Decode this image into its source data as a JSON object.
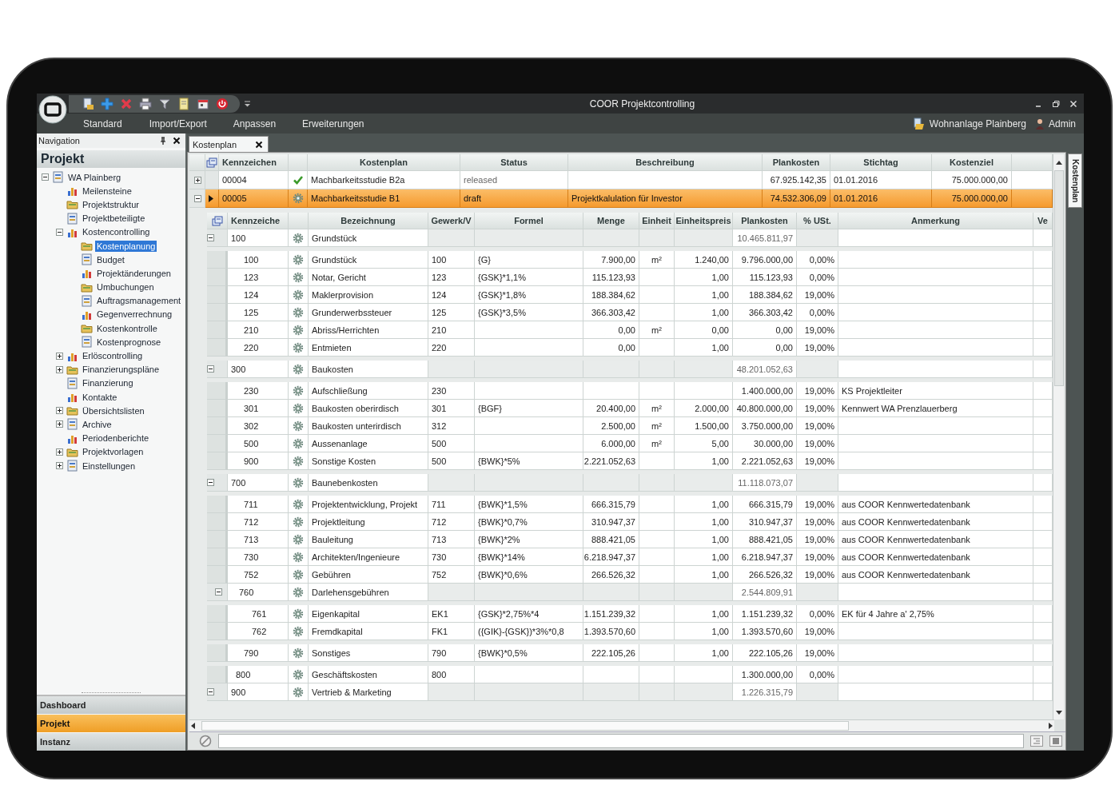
{
  "window": {
    "title": "COOR Projektcontrolling"
  },
  "menu": [
    "Standard",
    "Import/Export",
    "Anpassen",
    "Erweiterungen"
  ],
  "header_right": {
    "project": "Wohnanlage Plainberg",
    "user": "Admin"
  },
  "navigation": {
    "title": "Navigation",
    "heading": "Projekt",
    "tree": [
      {
        "label": "WA Plainberg",
        "expanded": true,
        "selected": false,
        "children": [
          {
            "label": "Meilensteine",
            "selected": false
          },
          {
            "label": "Projektstruktur",
            "selected": false
          },
          {
            "label": "Projektbeteiligte",
            "selected": false
          },
          {
            "label": "Kostencontrolling",
            "expanded": true,
            "selected": false,
            "children": [
              {
                "label": "Kostenplanung",
                "selected": true
              },
              {
                "label": "Budget",
                "selected": false
              },
              {
                "label": "Projektänderungen",
                "selected": false
              },
              {
                "label": "Umbuchungen",
                "selected": false
              },
              {
                "label": "Auftragsmanagement",
                "selected": false
              },
              {
                "label": "Gegenverrechnung",
                "selected": false
              },
              {
                "label": "Kostenkontrolle",
                "selected": false
              },
              {
                "label": "Kostenprognose",
                "selected": false
              }
            ]
          },
          {
            "label": "Erlöscontrolling",
            "expanded": false,
            "selected": false
          },
          {
            "label": "Finanzierungspläne",
            "expanded": false,
            "selected": false
          },
          {
            "label": "Finanzierung",
            "selected": false
          },
          {
            "label": "Kontakte",
            "selected": false
          },
          {
            "label": "Übersichtslisten",
            "expanded": false,
            "selected": false
          },
          {
            "label": "Archive",
            "expanded": false,
            "selected": false
          },
          {
            "label": "Periodenberichte",
            "selected": false
          },
          {
            "label": "Projektvorlagen",
            "expanded": false,
            "selected": false
          },
          {
            "label": "Einstellungen",
            "expanded": false,
            "selected": false
          }
        ]
      }
    ]
  },
  "bottom_tabs": [
    {
      "label": "Dashboard",
      "selected": false
    },
    {
      "label": "Projekt",
      "selected": true
    },
    {
      "label": "Instanz",
      "selected": false
    }
  ],
  "document_tabs": [
    {
      "label": "Kostenplan",
      "selected": true
    }
  ],
  "side_tab": "Kostenplan",
  "master": {
    "columns": [
      "Kennzeichen",
      "Kostenplan",
      "Status",
      "Beschreibung",
      "Plankosten",
      "Stichtag",
      "Kostenziel"
    ],
    "rows": [
      {
        "kennzeichen": "00004",
        "kind": "approved",
        "kostenplan": "Machbarkeitsstudie B2a",
        "status": "released",
        "plankosten": "67.925.142,35",
        "stichtag": "01.01.2016",
        "kostenziel": "75.000.000,00",
        "expanded": false,
        "selected": false
      },
      {
        "kennzeichen": "00005",
        "kind": "open",
        "kostenplan": "Machbarkeitsstudie B1",
        "status": "draft",
        "beschreibung": "Projektkalulation für Investor",
        "plankosten": "74.532.306,09",
        "stichtag": "01.01.2016",
        "kostenziel": "75.000.000,00",
        "expanded": true,
        "selected": true
      }
    ]
  },
  "detail": {
    "columns": [
      "Kennzeiche",
      "Bezeichnung",
      "Gewerk/V",
      "Formel",
      "Menge",
      "Einheit",
      "Einheitspreis",
      "Plankosten",
      "% USt.",
      "Anmerkung",
      "Ve"
    ],
    "rows": [
      {
        "kind": "group",
        "kennzeichen": "100",
        "bezeichnung": "Grundstück",
        "plankosten": "10.465.811,97",
        "expanded": true,
        "children": [
          {
            "kind": "item",
            "kennzeichen": "100",
            "bezeichnung": "Grundstück",
            "gewerk": "100",
            "formel": "{G}",
            "menge": "7.900,00",
            "einheit": "m²",
            "einheitspreis": "1.240,00",
            "plankosten": "9.796.000,00",
            "ust": "0,00%"
          },
          {
            "kind": "item",
            "kennzeichen": "123",
            "bezeichnung": "Notar, Gericht",
            "gewerk": "123",
            "formel": "{GSK}*1,1%",
            "menge": "115.123,93",
            "einheitspreis": "1,00",
            "plankosten": "115.123,93",
            "ust": "0,00%"
          },
          {
            "kind": "item",
            "kennzeichen": "124",
            "bezeichnung": "Maklerprovision",
            "gewerk": "124",
            "formel": "{GSK}*1,8%",
            "menge": "188.384,62",
            "einheitspreis": "1,00",
            "plankosten": "188.384,62",
            "ust": "19,00%"
          },
          {
            "kind": "item",
            "kennzeichen": "125",
            "bezeichnung": "Grunderwerbssteuer",
            "gewerk": "125",
            "formel": "{GSK}*3,5%",
            "menge": "366.303,42",
            "einheitspreis": "1,00",
            "plankosten": "366.303,42",
            "ust": "0,00%"
          },
          {
            "kind": "item",
            "kennzeichen": "210",
            "bezeichnung": "Abriss/Herrichten",
            "gewerk": "210",
            "menge": "0,00",
            "einheit": "m²",
            "einheitspreis": "0,00",
            "plankosten": "0,00",
            "ust": "19,00%"
          },
          {
            "kind": "item",
            "kennzeichen": "220",
            "bezeichnung": "Entmieten",
            "gewerk": "220",
            "menge": "0,00",
            "einheitspreis": "1,00",
            "plankosten": "0,00",
            "ust": "19,00%"
          }
        ]
      },
      {
        "kind": "group",
        "kennzeichen": "300",
        "bezeichnung": "Baukosten",
        "plankosten": "48.201.052,63",
        "expanded": true,
        "children": [
          {
            "kind": "item",
            "kennzeichen": "230",
            "bezeichnung": "Aufschließung",
            "gewerk": "230",
            "plankosten": "1.400.000,00",
            "ust": "19,00%",
            "anmerkung": "KS Projektleiter"
          },
          {
            "kind": "item",
            "kennzeichen": "301",
            "bezeichnung": "Baukosten oberirdisch",
            "gewerk": "301",
            "formel": "{BGF}",
            "menge": "20.400,00",
            "einheit": "m²",
            "einheitspreis": "2.000,00",
            "plankosten": "40.800.000,00",
            "ust": "19,00%",
            "anmerkung": "Kennwert WA Prenzlauerberg"
          },
          {
            "kind": "item",
            "kennzeichen": "302",
            "bezeichnung": "Baukosten unterirdisch",
            "gewerk": "312",
            "menge": "2.500,00",
            "einheit": "m²",
            "einheitspreis": "1.500,00",
            "plankosten": "3.750.000,00",
            "ust": "19,00%"
          },
          {
            "kind": "item",
            "kennzeichen": "500",
            "bezeichnung": "Aussenanlage",
            "gewerk": "500",
            "menge": "6.000,00",
            "einheit": "m²",
            "einheitspreis": "5,00",
            "plankosten": "30.000,00",
            "ust": "19,00%"
          },
          {
            "kind": "item",
            "kennzeichen": "900",
            "bezeichnung": "Sonstige Kosten",
            "gewerk": "500",
            "formel": "{BWK}*5%",
            "menge": "2.221.052,63",
            "einheitspreis": "1,00",
            "plankosten": "2.221.052,63",
            "ust": "19,00%"
          }
        ]
      },
      {
        "kind": "group",
        "kennzeichen": "700",
        "bezeichnung": "Baunebenkosten",
        "plankosten": "11.118.073,07",
        "expanded": true,
        "children": [
          {
            "kind": "item",
            "kennzeichen": "711",
            "bezeichnung": "Projektentwicklung, Projekt",
            "gewerk": "711",
            "formel": "{BWK}*1,5%",
            "menge": "666.315,79",
            "einheitspreis": "1,00",
            "plankosten": "666.315,79",
            "ust": "19,00%",
            "anmerkung": "aus COOR Kennwertedatenbank"
          },
          {
            "kind": "item",
            "kennzeichen": "712",
            "bezeichnung": "Projektleitung",
            "gewerk": "712",
            "formel": "{BWK}*0,7%",
            "menge": "310.947,37",
            "einheitspreis": "1,00",
            "plankosten": "310.947,37",
            "ust": "19,00%",
            "anmerkung": "aus COOR Kennwertedatenbank"
          },
          {
            "kind": "item",
            "kennzeichen": "713",
            "bezeichnung": "Bauleitung",
            "gewerk": "713",
            "formel": "{BWK}*2%",
            "menge": "888.421,05",
            "einheitspreis": "1,00",
            "plankosten": "888.421,05",
            "ust": "19,00%",
            "anmerkung": "aus COOR Kennwertedatenbank"
          },
          {
            "kind": "item",
            "kennzeichen": "730",
            "bezeichnung": "Architekten/Ingenieure",
            "gewerk": "730",
            "formel": "{BWK}*14%",
            "menge": "6.218.947,37",
            "einheitspreis": "1,00",
            "plankosten": "6.218.947,37",
            "ust": "19,00%",
            "anmerkung": "aus COOR Kennwertedatenbank"
          },
          {
            "kind": "item",
            "kennzeichen": "752",
            "bezeichnung": "Gebühren",
            "gewerk": "752",
            "formel": "{BWK}*0,6%",
            "menge": "266.526,32",
            "einheitspreis": "1,00",
            "plankosten": "266.526,32",
            "ust": "19,00%",
            "anmerkung": "aus COOR Kennwertedatenbank"
          },
          {
            "kind": "group",
            "kennzeichen": "760",
            "bezeichnung": "Darlehensgebühren",
            "plankosten": "2.544.809,91",
            "expanded": true,
            "children": [
              {
                "kind": "item",
                "kennzeichen": "761",
                "bezeichnung": "Eigenkapital",
                "gewerk": "EK1",
                "formel": "{GSK}*2,75%*4",
                "menge": "1.151.239,32",
                "einheitspreis": "1,00",
                "plankosten": "1.151.239,32",
                "ust": "0,00%",
                "anmerkung": "EK für 4 Jahre a' 2,75%"
              },
              {
                "kind": "item",
                "kennzeichen": "762",
                "bezeichnung": "Fremdkapital",
                "gewerk": "FK1",
                "formel": "({GIK}-{GSK})*3%*0,8",
                "menge": "1.393.570,60",
                "einheitspreis": "1,00",
                "plankosten": "1.393.570,60",
                "ust": "19,00%"
              }
            ]
          },
          {
            "kind": "item",
            "kennzeichen": "790",
            "bezeichnung": "Sonstiges",
            "gewerk": "790",
            "formel": "{BWK}*0,5%",
            "menge": "222.105,26",
            "einheitspreis": "1,00",
            "plankosten": "222.105,26",
            "ust": "19,00%"
          }
        ]
      },
      {
        "kind": "item",
        "kennzeichen": "800",
        "bezeichnung": "Geschäftskosten",
        "gewerk": "800",
        "plankosten": "1.300.000,00",
        "ust": "0,00%"
      },
      {
        "kind": "group",
        "kennzeichen": "900",
        "bezeichnung": "Vertrieb & Marketing",
        "plankosten": "1.226.315,79",
        "expanded": true
      }
    ]
  }
}
